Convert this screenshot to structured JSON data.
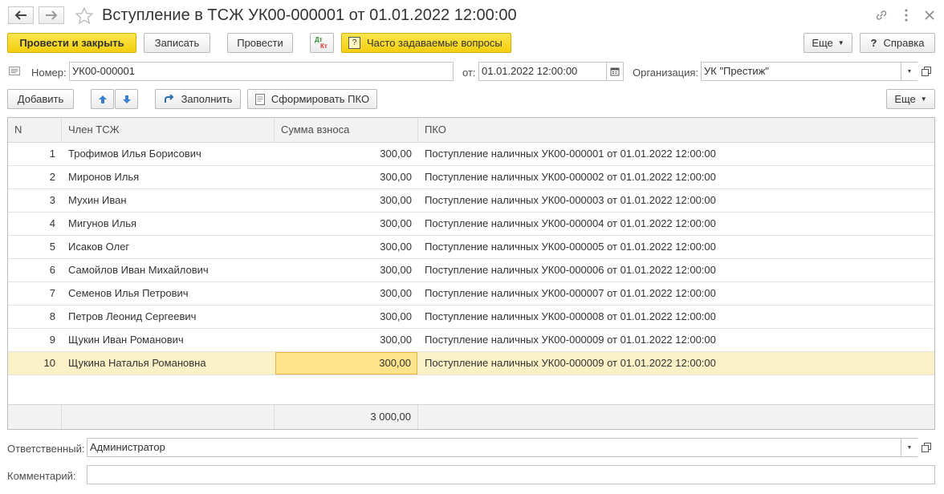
{
  "window": {
    "title": "Вступление в ТСЖ УК00-000001 от 01.01.2022 12:00:00",
    "back_icon": "arrow-left-icon",
    "forward_icon": "arrow-right-icon",
    "favorite_icon": "star-icon",
    "link_icon": "link-icon",
    "more_icon": "vertical-dots-icon",
    "close_icon": "close-icon"
  },
  "toolbar": {
    "post_close": "Провести и закрыть",
    "save": "Записать",
    "post": "Провести",
    "dtkt_top": "Дт",
    "dtkt_bottom": "Кт",
    "faq": "Часто задаваемые вопросы",
    "faq_icon": "?",
    "more": "Еще",
    "help": "Справка",
    "help_icon": "?"
  },
  "header": {
    "number_label": "Номер:",
    "number_value": "УК00-000001",
    "date_label": "от:",
    "date_value": "01.01.2022 12:00:00",
    "org_label": "Организация:",
    "org_value": "УК \"Престиж\""
  },
  "table_toolbar": {
    "add": "Добавить",
    "fill": "Заполнить",
    "create_pko": "Сформировать ПКО",
    "more": "Еще"
  },
  "table": {
    "columns": [
      "N",
      "Член ТСЖ",
      "Сумма взноса",
      "ПКО"
    ],
    "rows": [
      {
        "n": "1",
        "member": "Трофимов Илья Борисович",
        "amount": "300,00",
        "pko": "Поступление наличных УК00-000001 от 01.01.2022 12:00:00"
      },
      {
        "n": "2",
        "member": "Миронов Илья",
        "amount": "300,00",
        "pko": "Поступление наличных УК00-000002 от 01.01.2022 12:00:00"
      },
      {
        "n": "3",
        "member": "Мухин Иван",
        "amount": "300,00",
        "pko": "Поступление наличных УК00-000003 от 01.01.2022 12:00:00"
      },
      {
        "n": "4",
        "member": "Мигунов Илья",
        "amount": "300,00",
        "pko": "Поступление наличных УК00-000004 от 01.01.2022 12:00:00"
      },
      {
        "n": "5",
        "member": "Исаков Олег",
        "amount": "300,00",
        "pko": "Поступление наличных УК00-000005 от 01.01.2022 12:00:00"
      },
      {
        "n": "6",
        "member": "Самойлов Иван Михайлович",
        "amount": "300,00",
        "pko": "Поступление наличных УК00-000006 от 01.01.2022 12:00:00"
      },
      {
        "n": "7",
        "member": "Семенов Илья Петрович",
        "amount": "300,00",
        "pko": "Поступление наличных УК00-000007 от 01.01.2022 12:00:00"
      },
      {
        "n": "8",
        "member": "Петров Леонид Сергеевич",
        "amount": "300,00",
        "pko": "Поступление наличных УК00-000008 от 01.01.2022 12:00:00"
      },
      {
        "n": "9",
        "member": "Щукин Иван Романович",
        "amount": "300,00",
        "pko": "Поступление наличных УК00-000009 от 01.01.2022 12:00:00"
      },
      {
        "n": "10",
        "member": "Щукина Наталья Романовна",
        "amount": "300,00",
        "pko": "Поступление наличных УК00-000009 от 01.01.2022 12:00:00"
      }
    ],
    "total": "3 000,00"
  },
  "footer": {
    "responsible_label": "Ответственный:",
    "responsible_value": "Администратор",
    "comment_label": "Комментарий:",
    "comment_value": ""
  },
  "colors": {
    "accent_yellow": "#f5d31d",
    "selected_row": "#fbf1c6",
    "selected_cell": "#fde38a"
  }
}
